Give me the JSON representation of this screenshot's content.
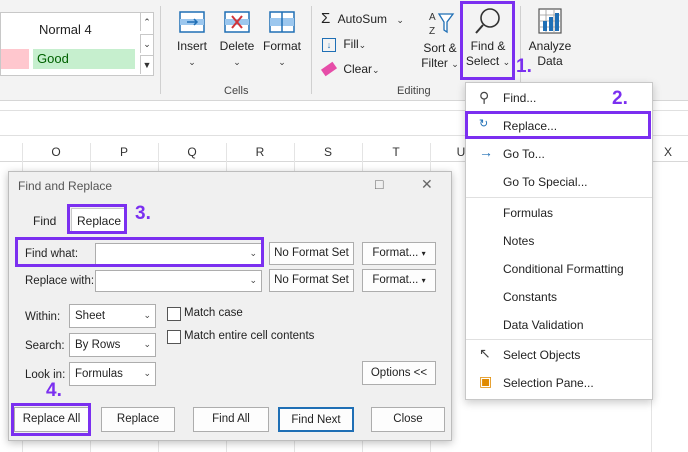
{
  "ribbon": {
    "styles": {
      "normal4": "Normal 4",
      "good": "Good"
    },
    "cells": {
      "insert": "Insert",
      "delete": "Delete",
      "format": "Format",
      "group_label": "Cells"
    },
    "editing": {
      "autosum": "AutoSum",
      "fill": "Fill",
      "clear": "Clear",
      "sort_filter_line1": "Sort &",
      "sort_filter_line2": "Filter",
      "find_select_line1": "Find &",
      "find_select_line2": "Select",
      "group_label": "Editing"
    },
    "analyze_line1": "Analyze",
    "analyze_line2": "Data"
  },
  "columns": [
    "O",
    "P",
    "Q",
    "R",
    "S",
    "T",
    "U",
    "X"
  ],
  "menu": {
    "items": [
      "Find...",
      "Replace...",
      "Go To...",
      "Go To Special...",
      "Formulas",
      "Notes",
      "Conditional Formatting",
      "Constants",
      "Data Validation",
      "Select Objects",
      "Selection Pane..."
    ]
  },
  "dialog": {
    "title": "Find and Replace",
    "tabs": {
      "find": "Find",
      "replace": "Replace"
    },
    "find_what_label": "Find what:",
    "replace_with_label": "Replace with:",
    "find_what_value": "",
    "replace_with_value": "",
    "no_format_set": "No Format Set",
    "format_btn": "Format...",
    "within_label": "Within:",
    "within_value": "Sheet",
    "search_label": "Search:",
    "search_value": "By Rows",
    "lookin_label": "Look in:",
    "lookin_value": "Formulas",
    "match_case": "Match case",
    "match_entire": "Match entire cell contents",
    "options_btn": "Options <<",
    "buttons": {
      "replace_all": "Replace All",
      "replace": "Replace",
      "find_all": "Find All",
      "find_next": "Find Next",
      "close": "Close"
    }
  },
  "annotations": {
    "step1": "1.",
    "step2": "2.",
    "step3": "3.",
    "step4": "4."
  },
  "accent_color": "#7b2ff0"
}
